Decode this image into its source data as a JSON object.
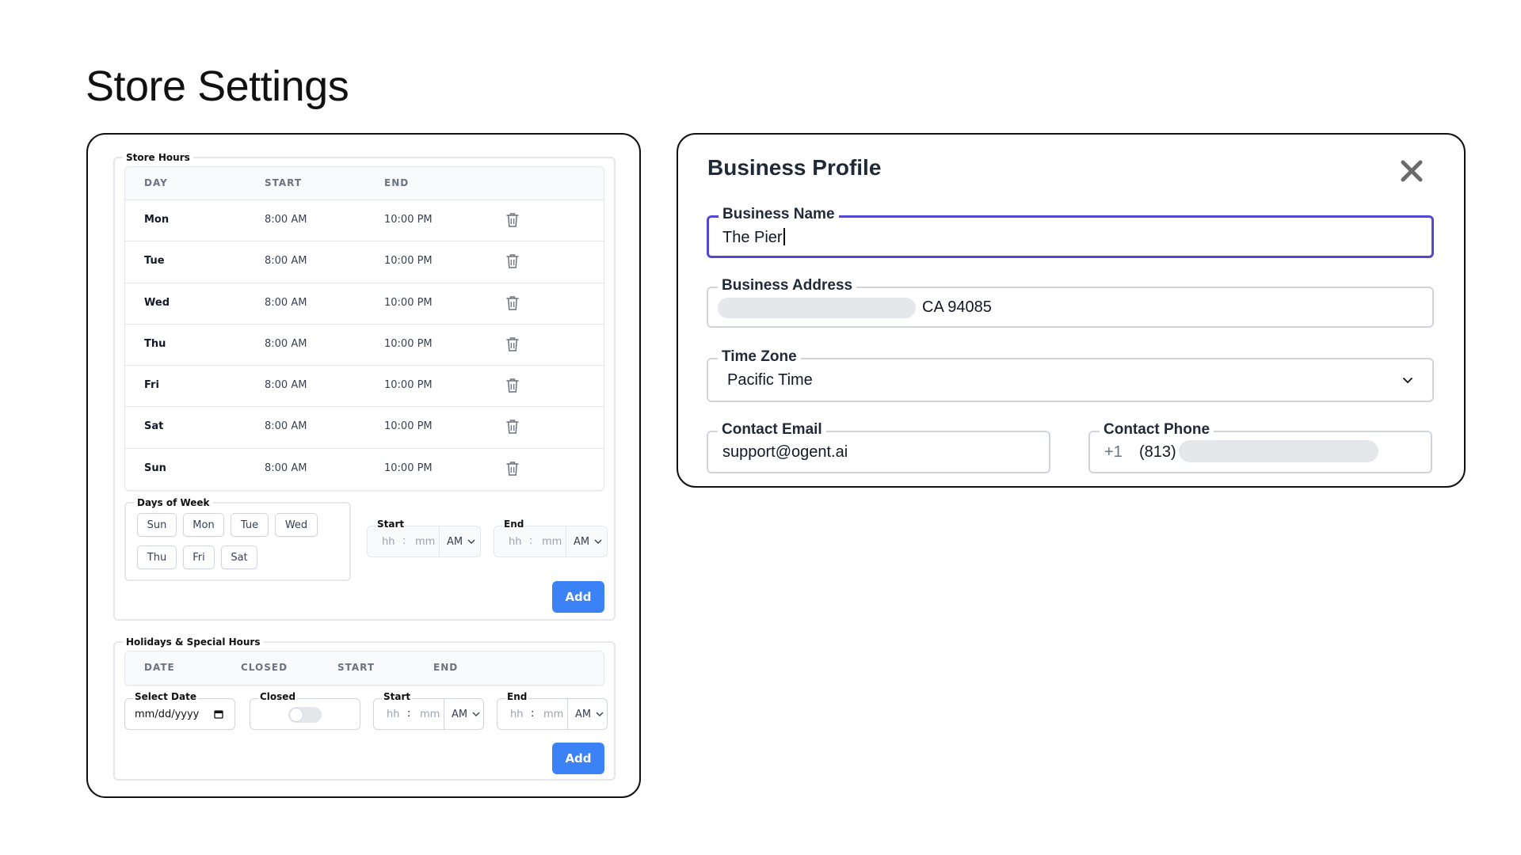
{
  "page": {
    "title": "Store Settings"
  },
  "store_hours": {
    "legend": "Store Hours",
    "headers": {
      "day": "DAY",
      "start": "START",
      "end": "END"
    },
    "rows": [
      {
        "day": "Mon",
        "start": "8:00 AM",
        "end": "10:00 PM"
      },
      {
        "day": "Tue",
        "start": "8:00 AM",
        "end": "10:00 PM"
      },
      {
        "day": "Wed",
        "start": "8:00 AM",
        "end": "10:00 PM"
      },
      {
        "day": "Thu",
        "start": "8:00 AM",
        "end": "10:00 PM"
      },
      {
        "day": "Fri",
        "start": "8:00 AM",
        "end": "10:00 PM"
      },
      {
        "day": "Sat",
        "start": "8:00 AM",
        "end": "10:00 PM"
      },
      {
        "day": "Sun",
        "start": "8:00 AM",
        "end": "10:00 PM"
      }
    ],
    "days_of_week": {
      "legend": "Days of Week",
      "chips": [
        "Sun",
        "Mon",
        "Tue",
        "Wed",
        "Thu",
        "Fri",
        "Sat"
      ]
    },
    "start": {
      "label": "Start",
      "hh": "hh",
      "mm": "mm",
      "sep": ":",
      "ampm": "AM"
    },
    "end": {
      "label": "End",
      "hh": "hh",
      "mm": "mm",
      "sep": ":",
      "ampm": "AM"
    },
    "add_label": "Add"
  },
  "holidays": {
    "legend": "Holidays & Special Hours",
    "headers": {
      "date": "DATE",
      "closed": "CLOSED",
      "start": "START",
      "end": "END"
    },
    "select_date": {
      "label": "Select Date",
      "placeholder": "mm/dd/yyyy"
    },
    "closed": {
      "label": "Closed"
    },
    "start": {
      "label": "Start",
      "hh": "hh",
      "mm": "mm",
      "sep": ":",
      "ampm": "AM"
    },
    "end": {
      "label": "End",
      "hh": "hh",
      "mm": "mm",
      "sep": ":",
      "ampm": "AM"
    },
    "add_label": "Add"
  },
  "business_profile": {
    "title": "Business Profile",
    "name": {
      "label": "Business Name",
      "value": "The Pier"
    },
    "address": {
      "label": "Business Address",
      "value": "CA 94085"
    },
    "timezone": {
      "label": "Time Zone",
      "value": "Pacific Time"
    },
    "email": {
      "label": "Contact Email",
      "value": "support@ogent.ai"
    },
    "phone": {
      "label": "Contact Phone",
      "country": "+1",
      "area": "(813)"
    }
  },
  "colors": {
    "accent": "#3b82f6",
    "focus": "#5348d6",
    "border": "#e5e7eb"
  }
}
